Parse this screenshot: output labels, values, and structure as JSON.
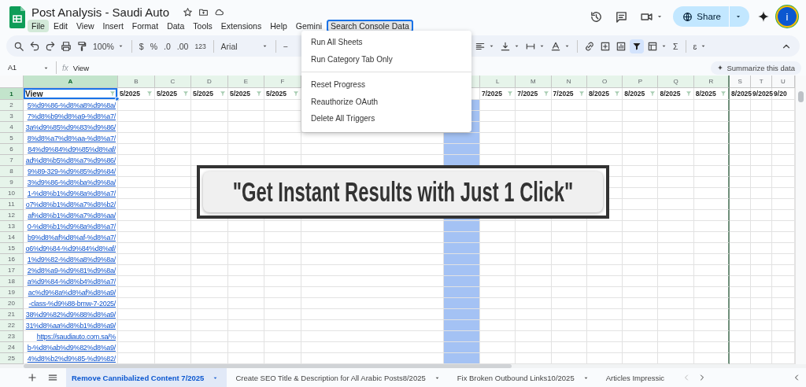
{
  "title": "Post Analysis - Saudi Auto",
  "menus": [
    {
      "label": "File",
      "hovered": true,
      "selected": false
    },
    {
      "label": "Edit",
      "hovered": false,
      "selected": false
    },
    {
      "label": "View",
      "hovered": false,
      "selected": false
    },
    {
      "label": "Insert",
      "hovered": false,
      "selected": false
    },
    {
      "label": "Format",
      "hovered": false,
      "selected": false
    },
    {
      "label": "Data",
      "hovered": false,
      "selected": false
    },
    {
      "label": "Tools",
      "hovered": false,
      "selected": false
    },
    {
      "label": "Extensions",
      "hovered": false,
      "selected": false
    },
    {
      "label": "Help",
      "hovered": false,
      "selected": false
    },
    {
      "label": "Gemini",
      "hovered": false,
      "selected": false
    },
    {
      "label": "Search Console Data",
      "hovered": false,
      "selected": true
    }
  ],
  "share_button": "Share",
  "avatar": "i",
  "toolbar": {
    "zoom": "100%",
    "currency": "$",
    "percent": "%",
    "decrease_decimal": ".0",
    "increase_decimal": ".00",
    "number_format": "123",
    "font": "Arial",
    "decrease_font_size": "−",
    "functions": "Σ",
    "input_tools": "ɛ",
    "filter_on": true
  },
  "formula_bar": {
    "name_box": "A1",
    "function_label": "fx",
    "formula": "View",
    "summarize_button": "Summarize this data"
  },
  "dropdown": [
    {
      "kind": "item",
      "label": "Run All Sheets"
    },
    {
      "kind": "item",
      "label": "Run Category Tab Only"
    },
    {
      "kind": "divider"
    },
    {
      "kind": "item",
      "label": "Reset Progress"
    },
    {
      "kind": "item",
      "label": "Reauthorize OAuth"
    },
    {
      "kind": "item",
      "label": "Delete All Triggers"
    }
  ],
  "columns": [
    {
      "letter": "A",
      "header": "View",
      "active": true,
      "in_filter": true,
      "highlighted": false
    },
    {
      "letter": "B",
      "header": "5/2025",
      "active": false,
      "in_filter": true,
      "highlighted": false
    },
    {
      "letter": "C",
      "header": "5/2025",
      "active": false,
      "in_filter": true,
      "highlighted": false
    },
    {
      "letter": "D",
      "header": "5/2025",
      "active": false,
      "in_filter": true,
      "highlighted": false
    },
    {
      "letter": "E",
      "header": "5/2025",
      "active": false,
      "in_filter": true,
      "highlighted": false
    },
    {
      "letter": "F",
      "header": "5/2025",
      "active": false,
      "in_filter": true,
      "highlighted": false
    },
    {
      "active": false,
      "in_filter": true,
      "highlighted": true
    },
    {
      "letter": "L",
      "header": "7/2025",
      "active": false,
      "in_filter": true,
      "highlighted": false
    },
    {
      "letter": "M",
      "header": "7/2025",
      "active": false,
      "in_filter": true,
      "highlighted": false
    },
    {
      "letter": "N",
      "header": "7/2025",
      "active": false,
      "in_filter": true,
      "highlighted": false
    },
    {
      "letter": "O",
      "header": "8/2025",
      "active": false,
      "in_filter": true,
      "highlighted": false
    },
    {
      "letter": "P",
      "header": "8/2025",
      "active": false,
      "in_filter": true,
      "highlighted": false
    },
    {
      "letter": "Q",
      "header": "8/2025",
      "active": false,
      "in_filter": true,
      "highlighted": false
    },
    {
      "letter": "R",
      "header": "8/2025",
      "active": false,
      "in_filter": true,
      "highlighted": false
    },
    {
      "letter": "S",
      "header": "8/2025",
      "active": false,
      "in_filter": false,
      "highlighted": false
    },
    {
      "letter": "T",
      "header": "9/2025",
      "active": false,
      "in_filter": false,
      "highlighted": false
    },
    {
      "letter": "U",
      "header": "9/20",
      "active": false,
      "in_filter": false,
      "highlighted": false
    }
  ],
  "rows": [
    {
      "number": "1",
      "active": true
    },
    {
      "number": "2",
      "active": false,
      "url": "5%d9%86-%d8%a8%d9%8a/"
    },
    {
      "number": "3",
      "active": false,
      "url": "7%d8%b9%d8%a9-%d8%a7/"
    },
    {
      "number": "4",
      "active": false,
      "url": "3a%d9%85%d9%83%d9%86/"
    },
    {
      "number": "5",
      "active": false,
      "url": "8%d8%a7%d8%aa-%d8%a7/"
    },
    {
      "number": "6",
      "active": false,
      "url": "84%d9%84%d9%85%d8%af/"
    },
    {
      "number": "7",
      "active": false,
      "url": "ad%d8%b5%d8%a7%d9%86/"
    },
    {
      "number": "8",
      "active": false,
      "url": "9%89-329-%d9%85%d9%84/"
    },
    {
      "number": "9",
      "active": false,
      "url": "3%d9%86-%d8%ba%d9%8a/"
    },
    {
      "number": "10",
      "active": false,
      "url": "1-%d8%b1%d9%8a%d8%a7/"
    },
    {
      "number": "11",
      "active": false,
      "url": "o7%d8%b1%d8%a7%d8%b2/"
    },
    {
      "number": "12",
      "active": false,
      "url": "af%d8%b1%d8%a7%d8%aa/"
    },
    {
      "number": "13",
      "active": false,
      "url": "0-%d8%b1%d9%8a%d8%a7/"
    },
    {
      "number": "14",
      "active": false,
      "url": "b9%d8%af%d8%af-%d8%a7/"
    },
    {
      "number": "15",
      "active": false,
      "url": "o6%d9%84-%d9%84%d8%af/"
    },
    {
      "number": "16",
      "active": false,
      "url": "1%d9%82-%d8%a8%d9%8a/"
    },
    {
      "number": "17",
      "active": false,
      "url": "2%d8%a9-%d9%81%d9%8a/"
    },
    {
      "number": "18",
      "active": false,
      "url": "a%d9%84-%d8%b4%d8%a7/"
    },
    {
      "number": "19",
      "active": false,
      "url": "ac%d9%8a%d8%af%d8%a9/"
    },
    {
      "number": "20",
      "active": false,
      "url": "-class-%d9%88-bmw-7-2025/"
    },
    {
      "number": "21",
      "active": false,
      "url": "38%d9%82%d9%88%d8%a9/"
    },
    {
      "number": "22",
      "active": false,
      "url": "31%d8%aa%d8%b1%d8%a9/"
    },
    {
      "number": "23",
      "active": false,
      "url": "https://saudiauto.com.sa/%"
    },
    {
      "number": "24",
      "active": false,
      "url": "b-%d8%ab%d9%82%d8%a9/"
    },
    {
      "number": "25",
      "active": false,
      "url": "4%d8%b2%d9%85-%d9%82/"
    }
  ],
  "banner": "\"Get Instant Results with Just 1 Click\"",
  "sheet_tabs": [
    {
      "label": "Remove Cannibalized Content 7/2025",
      "selected": true,
      "has_menu": true
    },
    {
      "label": "Create SEO Title & Description for All Arabic Posts8/2025",
      "selected": false,
      "has_menu": true
    },
    {
      "label": "Fix Broken Outbound Links10/2025",
      "selected": false,
      "has_menu": true
    },
    {
      "label": "Articles Impressic",
      "selected": false,
      "has_menu": false
    }
  ]
}
